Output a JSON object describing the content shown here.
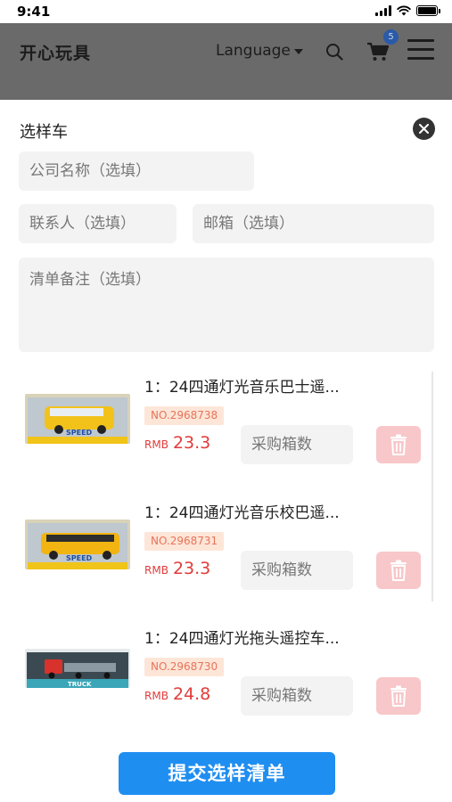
{
  "status_bar": {
    "time": "9:41"
  },
  "header": {
    "title": "开心玩具",
    "language_label": "Language",
    "cart_count": "5",
    "icons": [
      "search-icon",
      "cart-icon",
      "menu-icon",
      "chevron-down-icon"
    ]
  },
  "panel": {
    "title": "选样车",
    "company_placeholder": "公司名称（选填）",
    "contact_placeholder": "联系人（选填）",
    "email_placeholder": "邮箱（选填）",
    "notes_placeholder": "清单备注（选填）"
  },
  "products": [
    {
      "name": "1：24四通灯光音乐巴士遥...",
      "number": "NO.2968738",
      "currency": "RMB",
      "price": "23.3",
      "qty_placeholder": "采购箱数"
    },
    {
      "name": "1：24四通灯光音乐校巴遥...",
      "number": "NO.2968731",
      "currency": "RMB",
      "price": "23.3",
      "qty_placeholder": "采购箱数"
    },
    {
      "name": "1：24四通灯光拖头遥控车...",
      "number": "NO.2968730",
      "currency": "RMB",
      "price": "24.8",
      "qty_placeholder": "采购箱数"
    }
  ],
  "submit_label": "提交选样清单",
  "colors": {
    "accent": "#1f8ef1",
    "price": "#e23b3b",
    "badge_bg": "#fde6d8",
    "delete_bg": "#f8c7c9",
    "overlay": "#6a6a6a"
  }
}
